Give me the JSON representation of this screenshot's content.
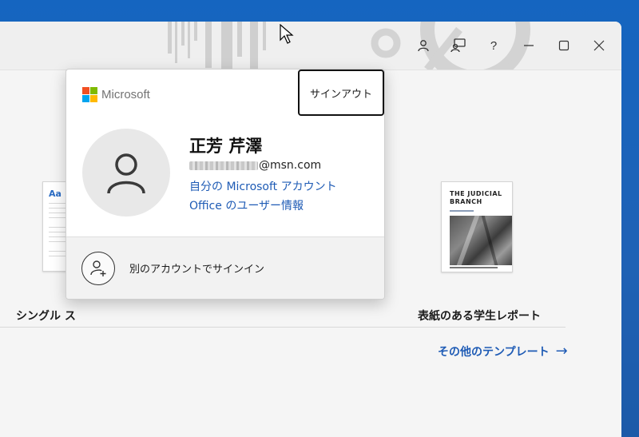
{
  "titlebar": {
    "icons": [
      "account-icon",
      "feedback-icon",
      "help-icon",
      "minimize-icon",
      "maximize-icon",
      "close-icon"
    ],
    "help_label": "?"
  },
  "flyout": {
    "brand": "Microsoft",
    "sign_out_label": "サインアウト",
    "user_name": "正芳 芹澤",
    "email_domain": "@msn.com",
    "link_account": "自分の Microsoft アカウント",
    "link_office": "Office のユーザー情報",
    "other_account_label": "別のアカウントでサインイン"
  },
  "templates": {
    "left_thumb_text": "Aa",
    "left_label": "シングル ス",
    "right_thumb_title": "THE JUDICIAL BRANCH",
    "right_label": "表紙のある学生レポート"
  },
  "more_templates": {
    "label": "その他のテンプレート",
    "arrow": "→"
  },
  "colors": {
    "link": "#1e5bb5",
    "ms_red": "#f25022",
    "ms_green": "#7fba00",
    "ms_blue": "#00a4ef",
    "ms_yellow": "#ffb900",
    "desktop": "#1565c0"
  }
}
